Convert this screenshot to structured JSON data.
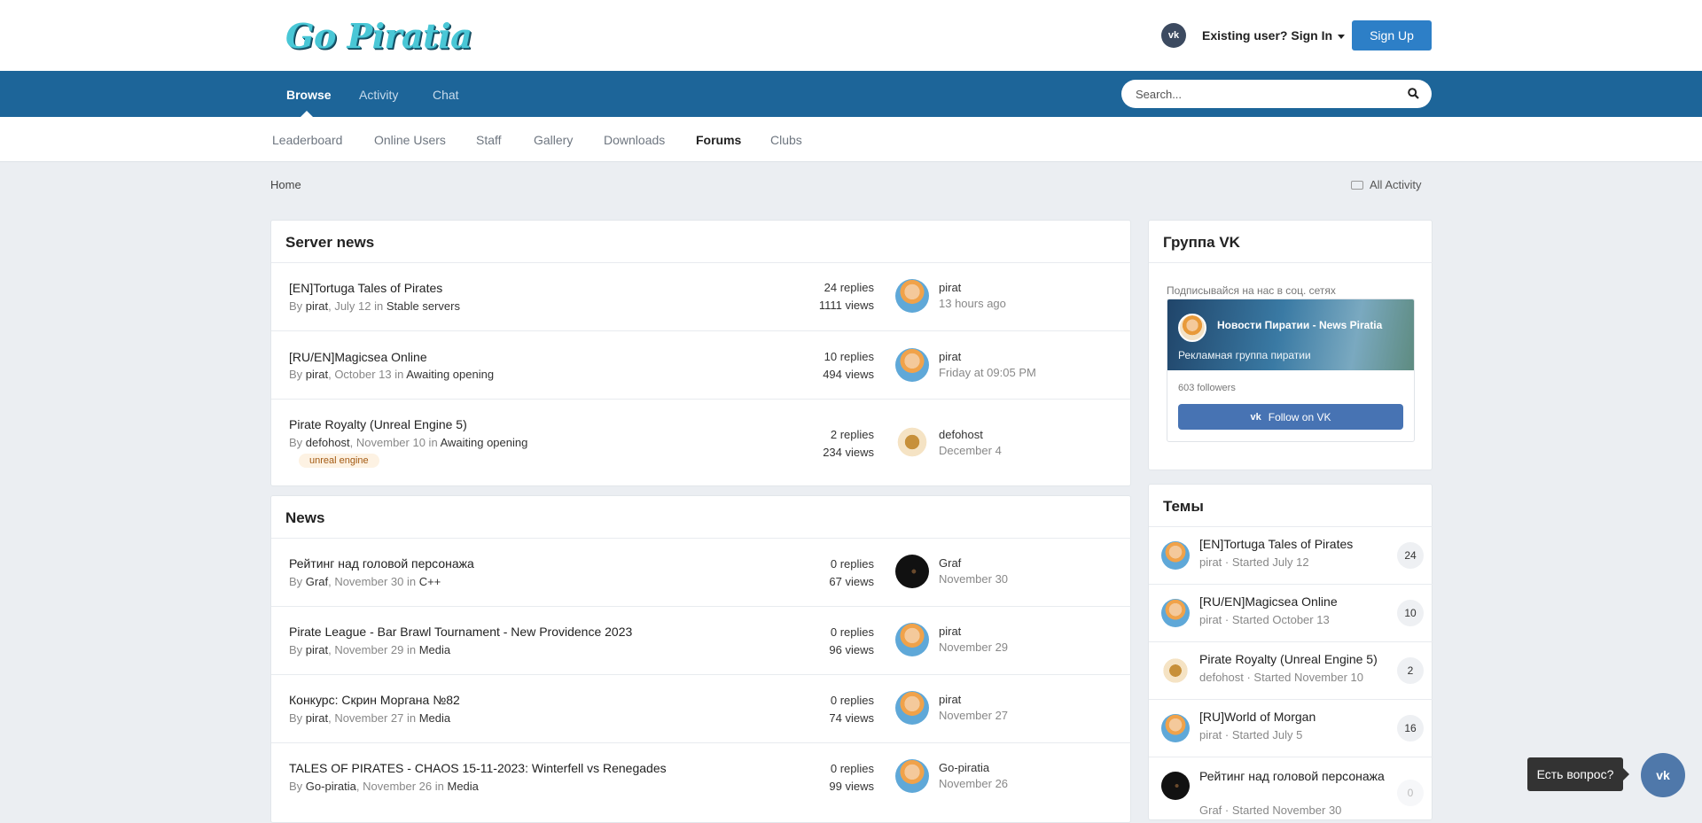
{
  "header": {
    "logo_text": "Go Piratia",
    "vk_icon": "vk-icon",
    "signin_label": "Existing user? Sign In",
    "signup_label": "Sign Up"
  },
  "nav": {
    "tabs": [
      {
        "label": "Browse",
        "active": true
      },
      {
        "label": "Activity"
      },
      {
        "label": "Chat"
      }
    ],
    "search_placeholder": "Search..."
  },
  "subnav": {
    "items": [
      {
        "label": "Leaderboard"
      },
      {
        "label": "Online Users"
      },
      {
        "label": "Staff"
      },
      {
        "label": "Gallery"
      },
      {
        "label": "Downloads"
      },
      {
        "label": "Forums",
        "active": true
      },
      {
        "label": "Clubs"
      }
    ]
  },
  "breadcrumb": {
    "home": "Home",
    "all_activity": "All Activity"
  },
  "server_news": {
    "title": "Server news",
    "topics": [
      {
        "title": "[EN]Tortuga Tales of Pirates",
        "by": "By",
        "author": "pirat",
        "date": ", July 12",
        "in": " in ",
        "forum": "Stable servers",
        "replies": "24 replies",
        "views": "1111 views",
        "last_user": "pirat",
        "last_date": "13 hours ago"
      },
      {
        "title": "[RU/EN]Magicsea Online",
        "by": "By",
        "author": "pirat",
        "date": ", October 13",
        "in": " in ",
        "forum": "Awaiting opening",
        "replies": "10 replies",
        "views": "494 views",
        "last_user": "pirat",
        "last_date": "Friday at 09:05 PM"
      },
      {
        "title": "Pirate Royalty (Unreal Engine 5)",
        "by": "By",
        "author": "defohost",
        "date": ", November 10",
        "in": " in ",
        "forum": "Awaiting opening",
        "tag": "unreal engine",
        "replies": "2 replies",
        "views": "234 views",
        "last_user": "defohost",
        "last_date": "December 4"
      }
    ]
  },
  "news": {
    "title": "News",
    "topics": [
      {
        "title": " Рейтинг над головой персонажа",
        "by": "By",
        "author": "Graf",
        "date": ", November 30",
        "in": " in ",
        "forum": "C++",
        "replies": "0 replies",
        "views": "67 views",
        "last_user": "Graf",
        "last_date": "November 30"
      },
      {
        "title": "Pirate League - Bar Brawl Tournament - New Providence 2023",
        "by": "By",
        "author": "pirat",
        "date": ", November 29",
        "in": " in ",
        "forum": "Media",
        "replies": "0 replies",
        "views": "96 views",
        "last_user": "pirat",
        "last_date": "November 29"
      },
      {
        "title": "Конкурс: Скрин Моргана №82",
        "by": "By",
        "author": "pirat",
        "date": ", November 27",
        "in": " in ",
        "forum": "Media",
        "replies": "0 replies",
        "views": "74 views",
        "last_user": "pirat",
        "last_date": "November 27"
      },
      {
        "title": "TALES OF PIRATES - CHAOS 15-11-2023: Winterfell vs Renegades",
        "by": "By",
        "author": "Go-piratia",
        "date": ", November 26",
        "in": " in ",
        "forum": "Media",
        "replies": "0 replies",
        "views": "99 views",
        "last_user": "Go-piratia",
        "last_date": "November 26"
      }
    ]
  },
  "vk_group": {
    "title": "Группа VK",
    "subtitle": "Подписывайся на нас в соц. сетях",
    "banner_name": "Новости Пиратии - News Piratia",
    "banner_desc": "Рекламная группа пиратии",
    "followers": "603 followers",
    "follow_label": "Follow on VK"
  },
  "topics_widget": {
    "title": "Темы",
    "items": [
      {
        "title": "[EN]Tortuga Tales of Pirates",
        "meta": "pirat · Started July 12",
        "count": "24"
      },
      {
        "title": "[RU/EN]Magicsea Online",
        "meta": "pirat · Started October 13",
        "count": "10"
      },
      {
        "title": "Pirate Royalty (Unreal Engine 5)",
        "meta": "defohost · Started November 10",
        "count": "2"
      },
      {
        "title": "[RU]World of Morgan",
        "meta": "pirat · Started July 5",
        "count": "16"
      },
      {
        "title": " Рейтинг над головой персонажа",
        "meta": "Graf · Started November 30",
        "count": "0"
      }
    ]
  },
  "chat_widget": {
    "tooltip": "Есть вопрос?",
    "icon": "vk-icon"
  }
}
